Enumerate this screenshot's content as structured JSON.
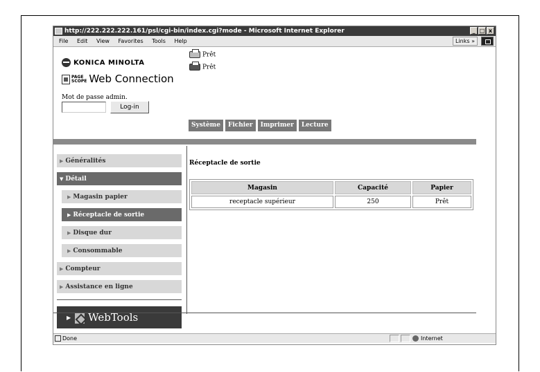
{
  "browser": {
    "title": "http://222.222.222.161/psl/cgi-bin/index.cgi?mode - Microsoft Internet Explorer",
    "window_buttons": [
      "_",
      "б",
      "x"
    ],
    "menu": [
      "File",
      "Edit",
      "View",
      "Favorites",
      "Tools",
      "Help"
    ],
    "links_label": "Links »",
    "status_text": "Done",
    "zone_text": "Internet"
  },
  "header": {
    "brand": "KONICA MINOLTA",
    "pagescope_top": "PAGE",
    "pagescope_bottom": "SCOPE",
    "product": "Web Connection",
    "password_label": "Mot de passe admin.",
    "login_button": "Log-in",
    "status_1": "Prêt",
    "status_2": "Prêt"
  },
  "tabs": [
    "Système",
    "Fichier",
    "Imprimer",
    "Lecture"
  ],
  "nav": {
    "generalites": "Généralités",
    "detail": "Détail",
    "magasin_papier": "Magasin papier",
    "receptacle": "Réceptacle de sortie",
    "disque_dur": "Disque dur",
    "consommable": "Consommable",
    "compteur": "Compteur",
    "assistance": "Assistance en ligne",
    "webtools": "WebTools"
  },
  "main": {
    "section_title": "Réceptacle de sortie",
    "table": {
      "headers": [
        "Magasin",
        "Capacité",
        "Papier"
      ],
      "rows": [
        [
          "receptacle supérieur",
          "250",
          "Prêt"
        ]
      ]
    }
  }
}
